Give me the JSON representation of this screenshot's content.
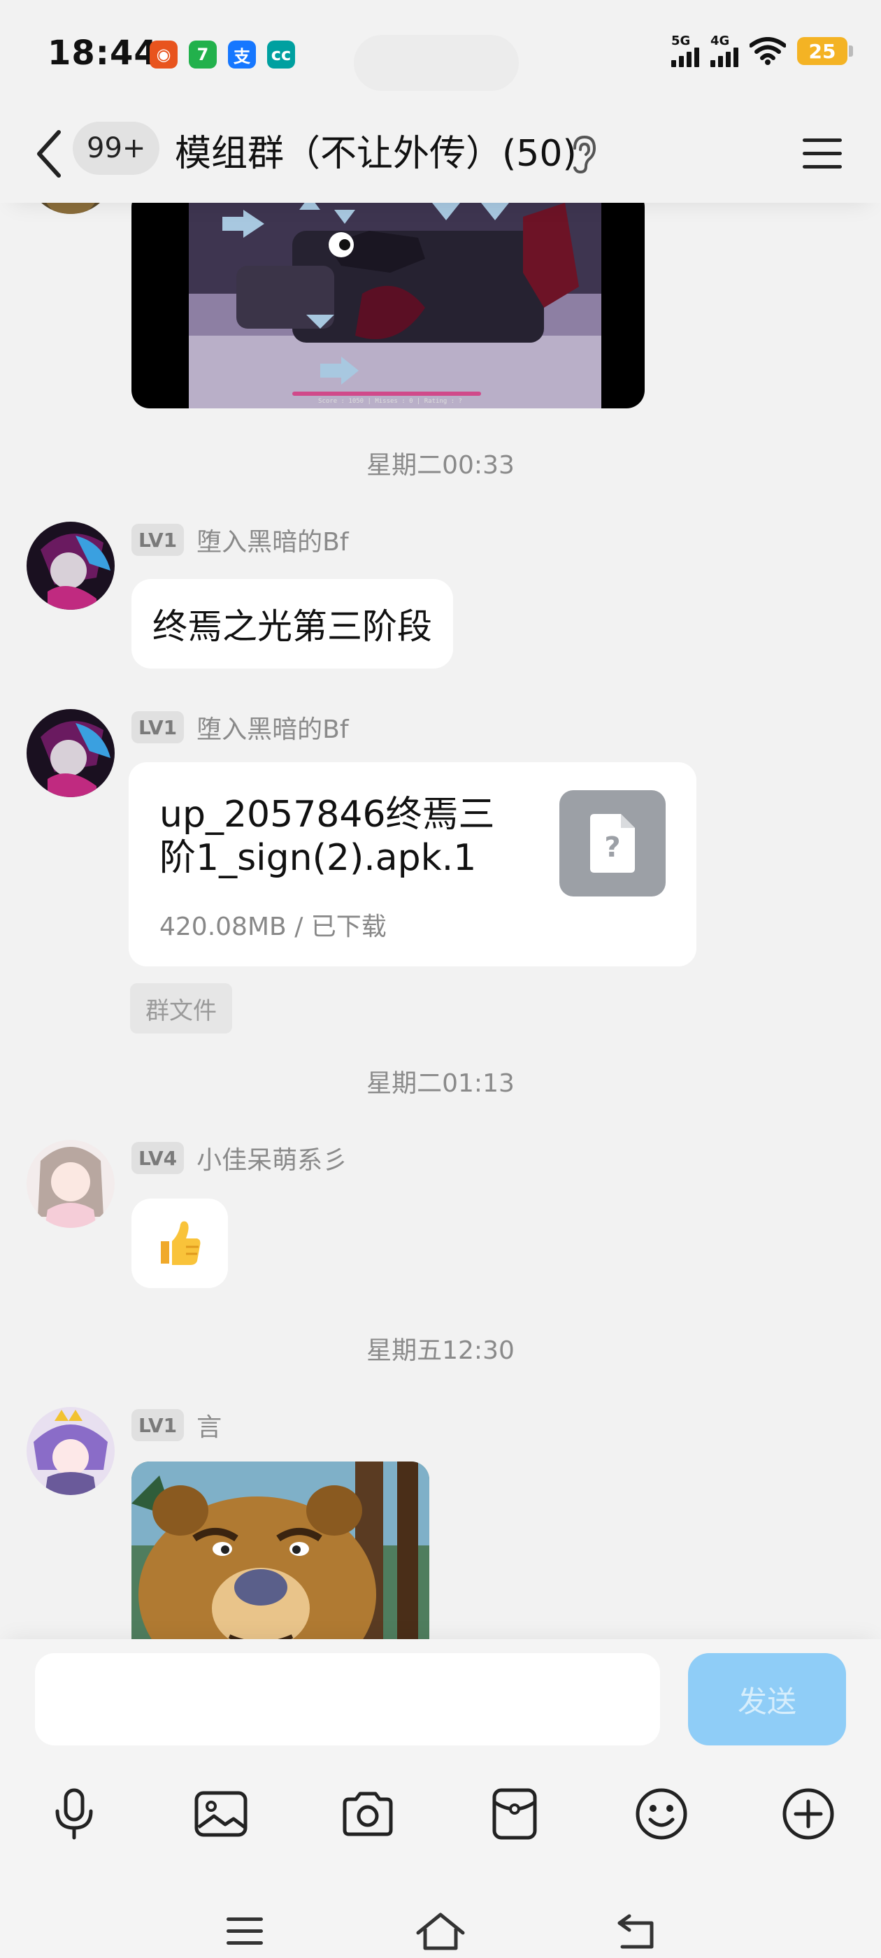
{
  "status_bar": {
    "time": "18:44",
    "app_icons": [
      {
        "name": "weibo-app-icon",
        "glyph": "◉",
        "color": "#e8541e"
      },
      {
        "name": "app-7-icon",
        "glyph": "7",
        "color": "#22b14c"
      },
      {
        "name": "alipay-app-icon",
        "glyph": "支",
        "color": "#1677ff"
      },
      {
        "name": "cc-app-icon",
        "glyph": "cc",
        "color": "#00a0a0"
      }
    ],
    "network_1": "5G",
    "network_2": "4G",
    "battery": "25"
  },
  "header": {
    "unread_count": "99+",
    "title": "模组群（不让外传）(50)"
  },
  "chat": {
    "messages": [
      {
        "time": "星期二00:33"
      },
      {
        "level": "LV1",
        "sender": "堕入黑暗的Bf",
        "text": "终焉之光第三阶段"
      },
      {
        "level": "LV1",
        "sender": "堕入黑暗的Bf",
        "file": {
          "name": "up_2057846终焉三阶1_sign(2).apk.1",
          "size": "420.08MB",
          "status": "已下载",
          "icon_glyph": "?"
        },
        "tag": "群文件"
      },
      {
        "time": "星期二01:13"
      },
      {
        "level": "LV4",
        "sender": "小佳呆萌系彡",
        "emoji": "👍"
      },
      {
        "time": "星期五12:30"
      },
      {
        "level": "LV1",
        "sender": "言"
      }
    ],
    "video_hud": "Score : 1050 | Misses : 0 | Rating : ?"
  },
  "input": {
    "placeholder": "",
    "send_label": "发送"
  },
  "colors": {
    "send_button": "#8fcdf7",
    "background": "#f2f2f2",
    "bubble": "#ffffff",
    "file_icon": "#9ca0a6"
  }
}
